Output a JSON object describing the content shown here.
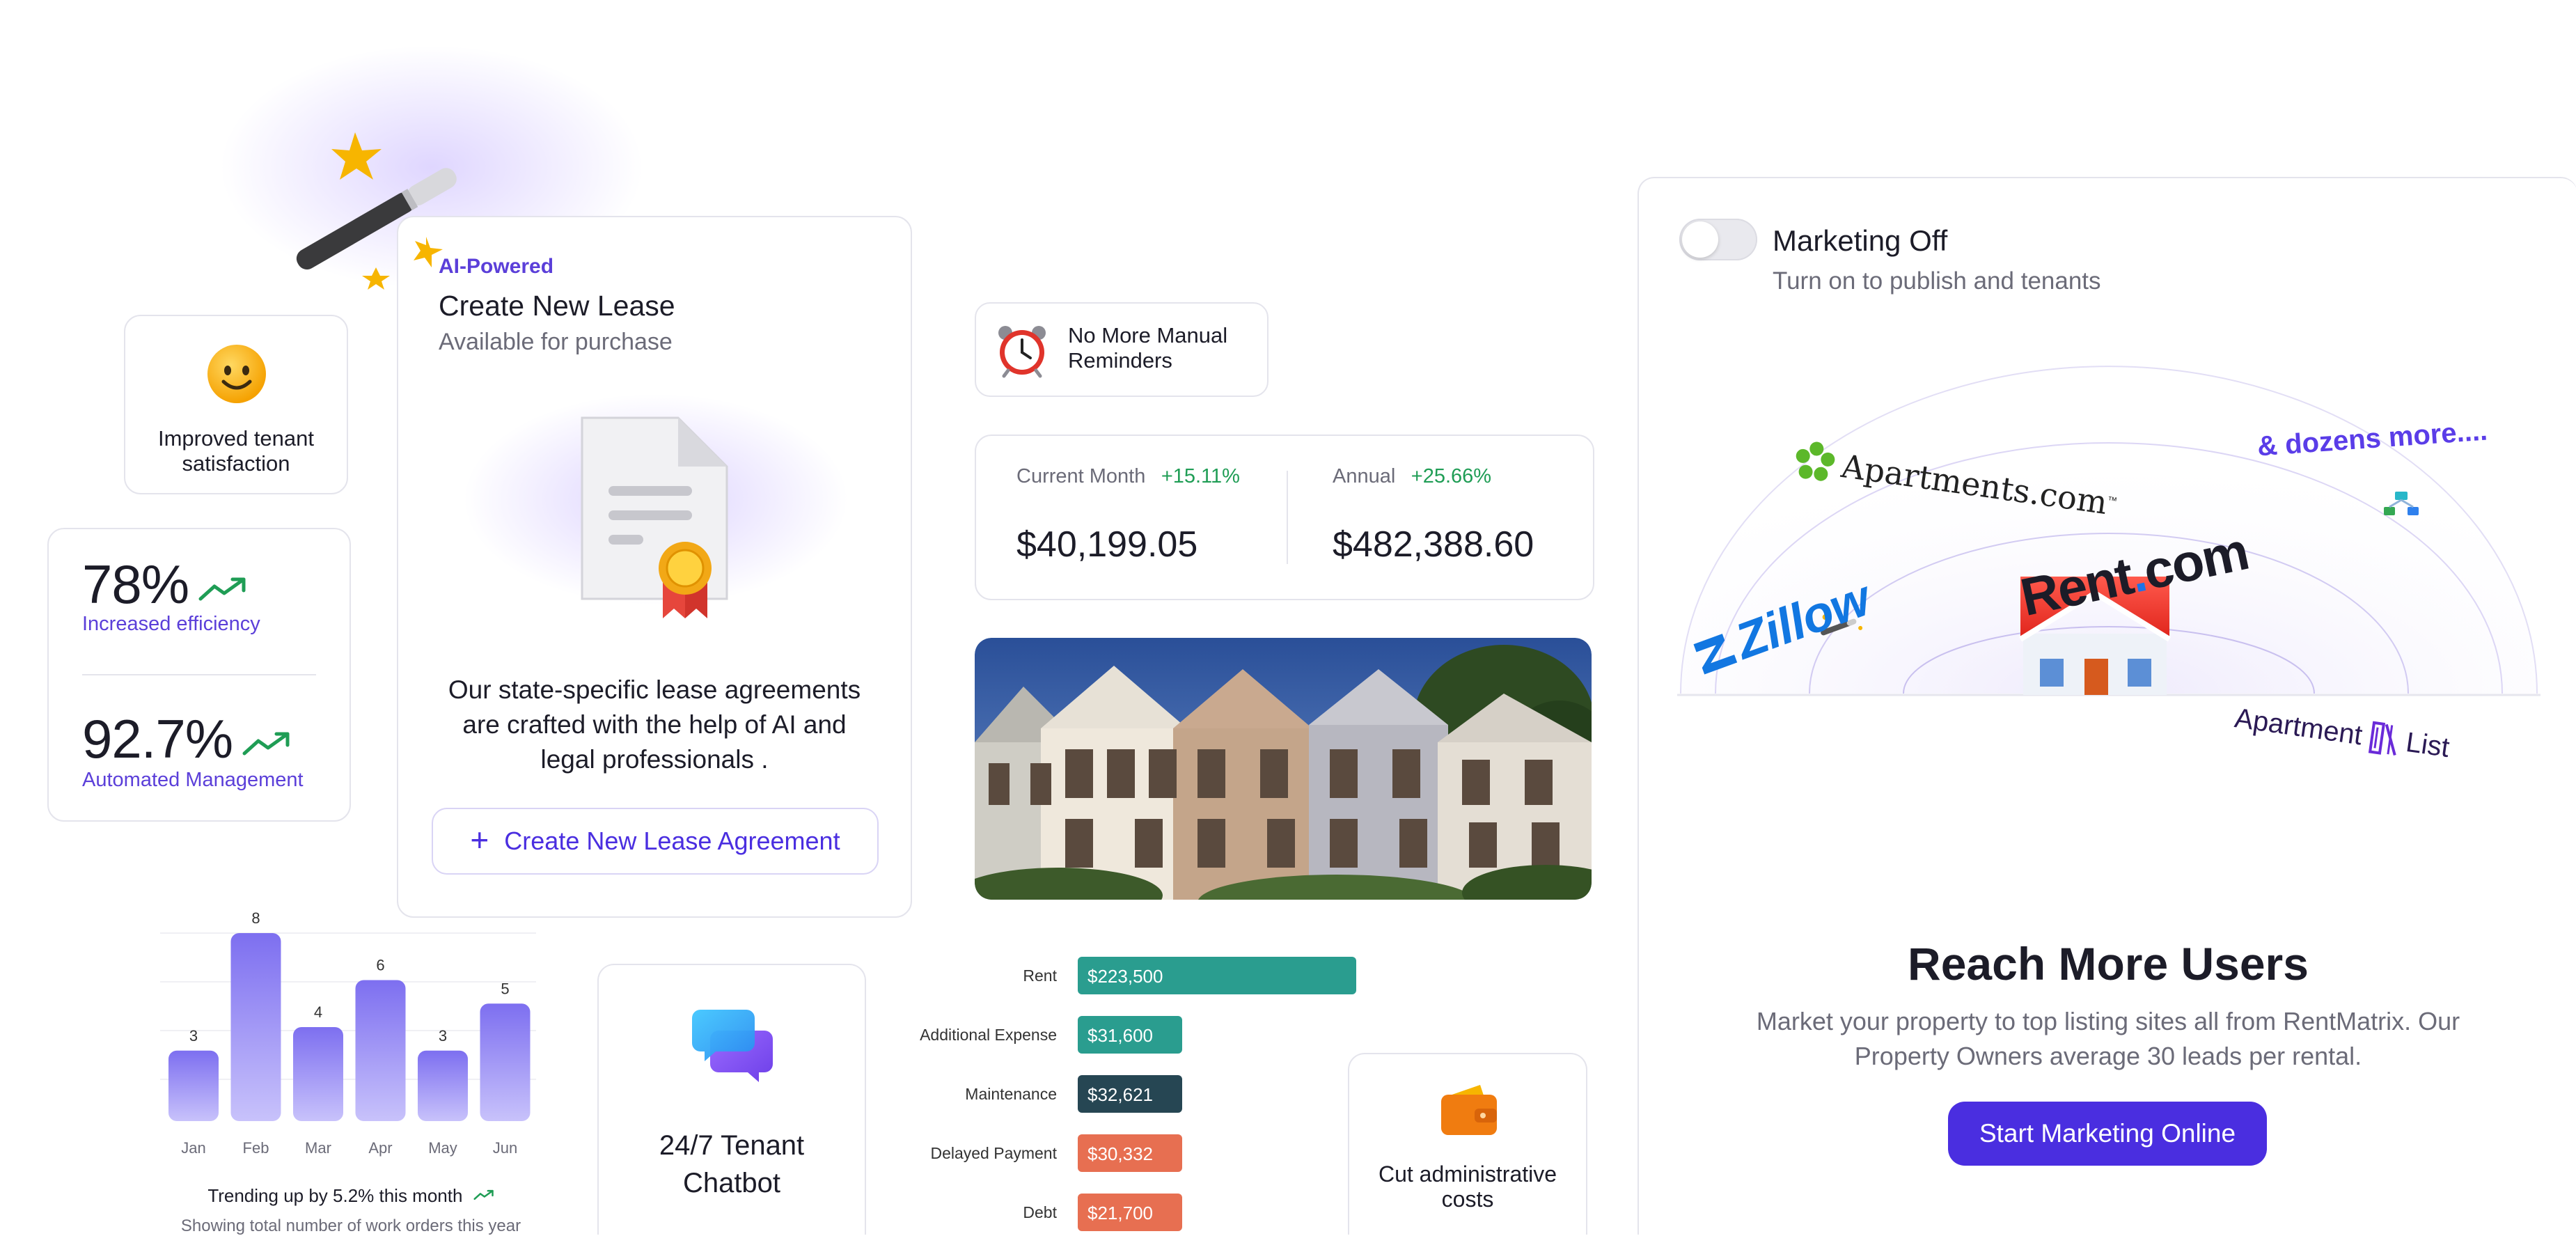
{
  "ai_card": {
    "badge": "AI-Powered",
    "title": "Create New Lease",
    "subtitle": "Available for purchase",
    "description": "Our state-specific lease agreements are crafted with the help of AI and legal professionals .",
    "button_label": "Create New Lease Agreement"
  },
  "satisfaction": {
    "label": "Improved tenant satisfaction"
  },
  "stats": [
    {
      "value": "78%",
      "label": "Increased efficiency"
    },
    {
      "value": "92.7%",
      "label": "Automated Management"
    }
  ],
  "reminder": {
    "label": "No More Manual Reminders"
  },
  "revenue": {
    "current_label": "Current Month",
    "current_change": "+15.11%",
    "current_value": "$40,199.05",
    "annual_label": "Annual",
    "annual_change": "+25.66%",
    "annual_value": "$482,388.60"
  },
  "chart_data": [
    {
      "type": "bar",
      "categories": [
        "Jan",
        "Feb",
        "Mar",
        "Apr",
        "May",
        "Jun"
      ],
      "values": [
        3,
        8,
        4,
        6,
        3,
        5
      ],
      "title": "",
      "ylim": [
        0,
        8
      ],
      "footer_title": "Trending up by 5.2% this month",
      "footer_subtitle": "Showing total number of work orders this year"
    },
    {
      "type": "bar",
      "orientation": "horizontal",
      "categories": [
        "Rent",
        "Additional Expense",
        "Maintenance",
        "Delayed Payment",
        "Debt"
      ],
      "values": [
        223500,
        31600,
        32621,
        30332,
        21700
      ],
      "value_labels": [
        "$223,500",
        "$31,600",
        "$32,621",
        "$30,332",
        "$21,700"
      ],
      "colors": [
        "#2a9d8f",
        "#2a9d8f",
        "#264653",
        "#e76f51",
        "#e76f51"
      ]
    }
  ],
  "chatbot": {
    "label": "24/7 Tenant Chatbot"
  },
  "admin": {
    "label": "Cut administrative costs"
  },
  "marketing": {
    "toggle_label": "Marketing Off",
    "toggle_sub": "Turn on to publish and tenants",
    "toggle_on": false,
    "logos": {
      "apartments": "Apartments.com",
      "apartments_tm": "™",
      "more": "& dozens more....",
      "zillow": "Zillow",
      "rent": "Rent",
      "rent_dot": ".",
      "rent_com": "com",
      "apartment_list_1": "Apartment",
      "apartment_list_2": "List"
    },
    "heading": "Reach More Users",
    "description": "Market your property to top listing sites all from RentMatrix. Our Property Owners average 30 leads per rental.",
    "button_label": "Start Marketing Online"
  },
  "colors": {
    "accent": "#4a2ee0",
    "positive": "#1f9d55",
    "border": "#e4e4ec"
  }
}
